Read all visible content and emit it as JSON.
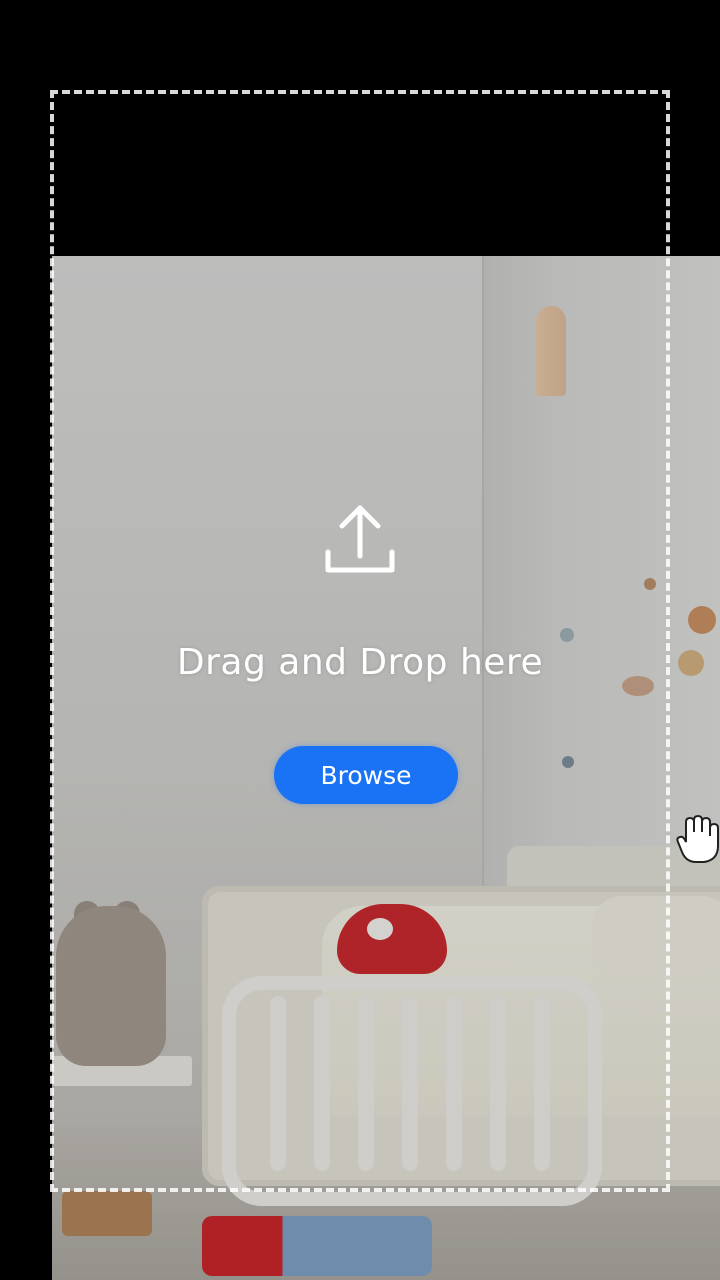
{
  "drop_zone": {
    "instruction": "Drag and Drop here",
    "browse_label": "Browse",
    "icon": "upload-icon"
  },
  "cursor": {
    "icon": "hand-cursor-icon"
  },
  "colors": {
    "accent": "#1a73f5",
    "dash": "#ffffff",
    "background": "#000000"
  }
}
